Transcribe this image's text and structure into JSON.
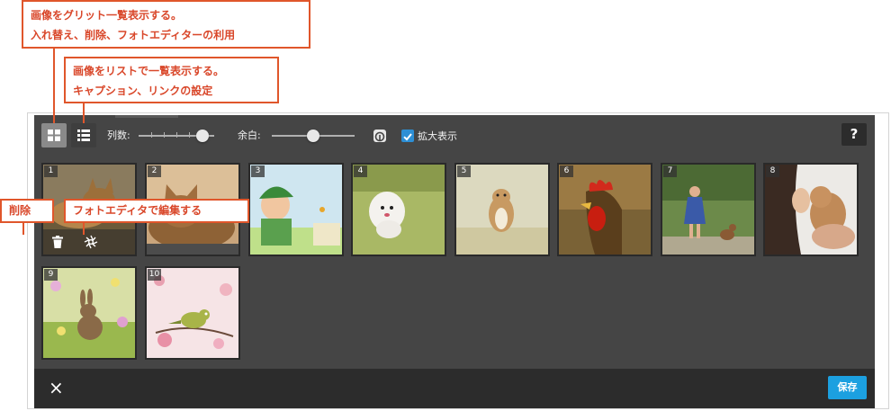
{
  "callouts": {
    "grid_line1": "画像をグリット一覧表示する。",
    "grid_line2": "入れ替え、削除、フォトエディターの利用",
    "list_line1": "画像をリストで一覧表示する。",
    "list_line2": "キャプション、リンクの設定",
    "delete": "削除",
    "photo_editor": "フォトエディタで編集する"
  },
  "toolbar": {
    "columns_label": "列数:",
    "columns_level": 0.85,
    "spacing_label": "余白:",
    "spacing_level": 0.5,
    "zoom_label": "拡大表示",
    "zoom_checked": true,
    "help_label": "?"
  },
  "thumbnails": [
    {
      "num": "1",
      "subject": "cat-photo"
    },
    {
      "num": "2",
      "subject": "cat-photo"
    },
    {
      "num": "3",
      "subject": "child-photo"
    },
    {
      "num": "4",
      "subject": "dog-photo"
    },
    {
      "num": "5",
      "subject": "chipmunk-photo"
    },
    {
      "num": "6",
      "subject": "rooster-photo"
    },
    {
      "num": "7",
      "subject": "girl-dog-photo"
    },
    {
      "num": "8",
      "subject": "woman-dog-photo"
    },
    {
      "num": "9",
      "subject": "rabbit-photo"
    },
    {
      "num": "10",
      "subject": "bird-photo"
    }
  ],
  "footer": {
    "close_icon": "×",
    "save_label": "保存"
  },
  "colors": {
    "accent": "#1ca0e0",
    "callout": "#e0562b",
    "editor_bg": "#454545"
  }
}
